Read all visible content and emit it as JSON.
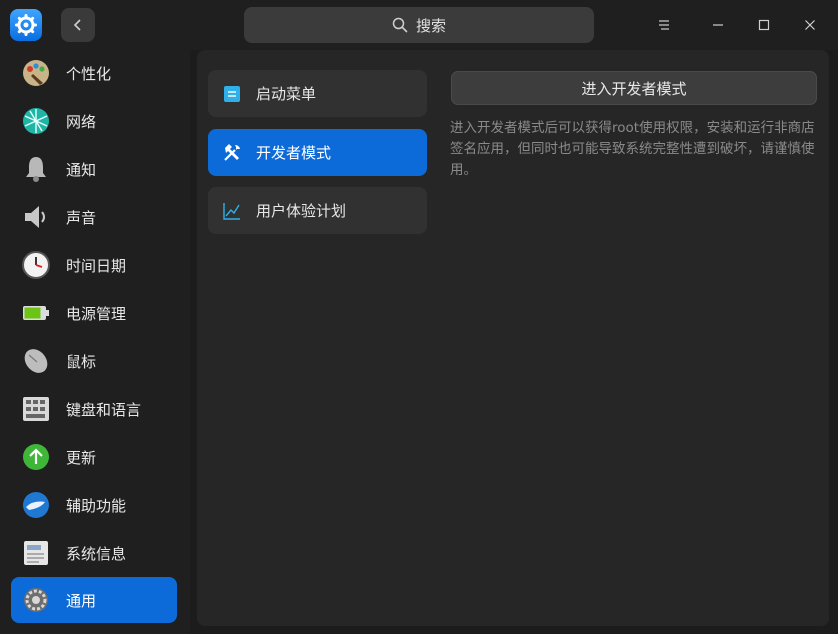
{
  "titlebar": {
    "search_placeholder": "搜索"
  },
  "sidebar": {
    "items": [
      {
        "label": "个性化",
        "icon": "personalization-icon"
      },
      {
        "label": "网络",
        "icon": "network-icon"
      },
      {
        "label": "通知",
        "icon": "bell-icon"
      },
      {
        "label": "声音",
        "icon": "speaker-icon"
      },
      {
        "label": "时间日期",
        "icon": "clock-icon"
      },
      {
        "label": "电源管理",
        "icon": "battery-icon"
      },
      {
        "label": "鼠标",
        "icon": "mouse-icon"
      },
      {
        "label": "键盘和语言",
        "icon": "keyboard-icon"
      },
      {
        "label": "更新",
        "icon": "update-arrow-icon"
      },
      {
        "label": "辅助功能",
        "icon": "accessibility-hand-icon"
      },
      {
        "label": "系统信息",
        "icon": "system-info-icon"
      },
      {
        "label": "通用",
        "icon": "gear-icon",
        "active": true
      }
    ]
  },
  "subnav": {
    "items": [
      {
        "label": "启动菜单",
        "icon": "boot-menu-icon"
      },
      {
        "label": "开发者模式",
        "icon": "developer-tools-icon",
        "active": true
      },
      {
        "label": "用户体验计划",
        "icon": "trend-chart-icon"
      }
    ]
  },
  "content": {
    "enter_dev_mode_button": "进入开发者模式",
    "description": "进入开发者模式后可以获得root使用权限，安装和运行非商店签名应用，但同时也可能导致系统完整性遭到破坏，请谨慎使用。"
  },
  "colors": {
    "accent": "#0c6bd8",
    "background": "#1c1c1c",
    "panel": "#262626"
  }
}
